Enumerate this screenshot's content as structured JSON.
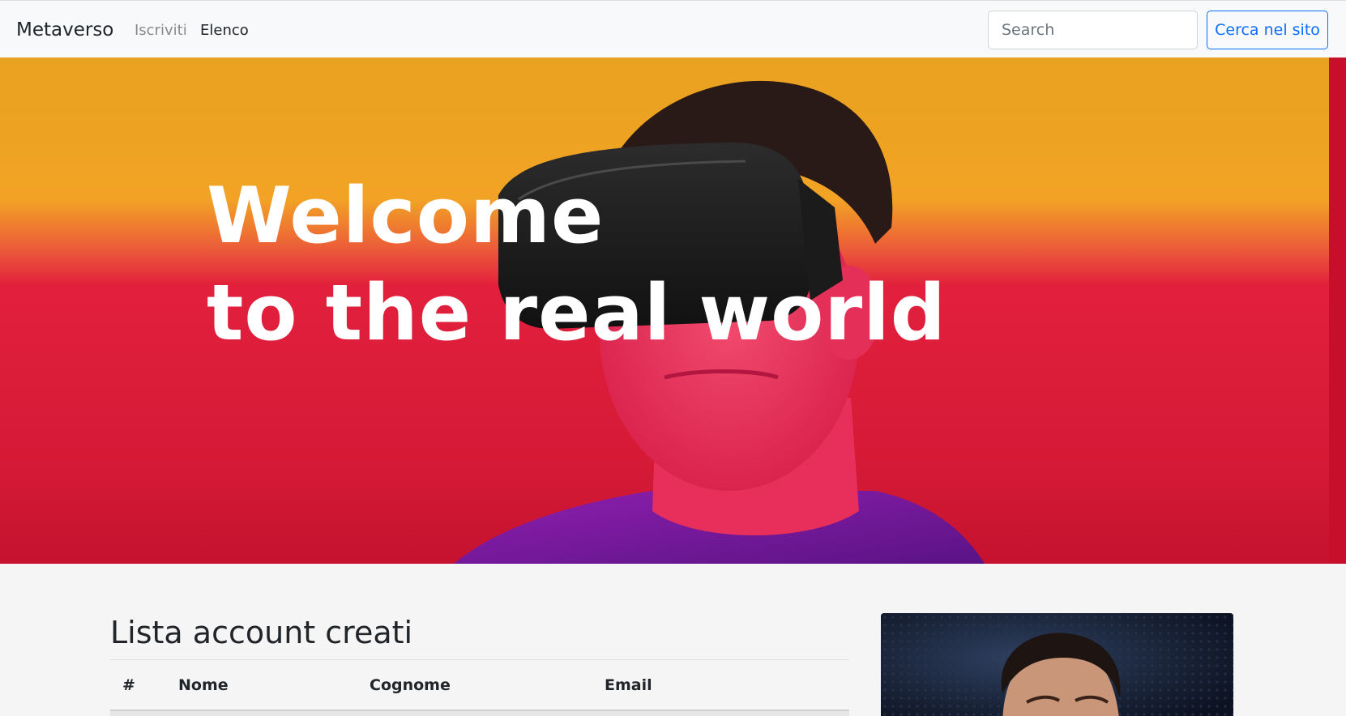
{
  "navbar": {
    "brand": "Metaverso",
    "links": [
      {
        "label": "Iscriviti",
        "state": "muted"
      },
      {
        "label": "Elenco",
        "state": "active"
      }
    ],
    "search": {
      "placeholder": "Search",
      "value": ""
    },
    "search_button": "Cerca nel sito"
  },
  "hero": {
    "title_line1": "Welcome",
    "title_line2": "to the real world"
  },
  "main": {
    "section_title": "Lista account creati",
    "table": {
      "columns": [
        "#",
        "Nome",
        "Cognome",
        "Email"
      ],
      "rows": []
    }
  },
  "colors": {
    "primary": "#0d6efd",
    "hero_orange": "#f2a325",
    "hero_red": "#e2203d"
  }
}
